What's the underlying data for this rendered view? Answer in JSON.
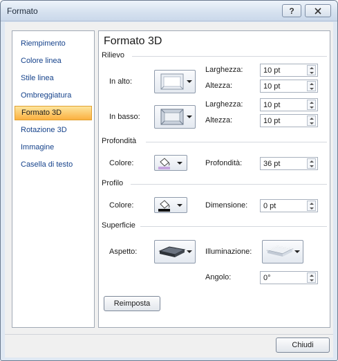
{
  "window": {
    "title": "Formato",
    "help_label": "?",
    "close_label": "☒"
  },
  "nav": {
    "items": [
      {
        "label": "Riempimento"
      },
      {
        "label": "Colore linea"
      },
      {
        "label": "Stile linea"
      },
      {
        "label": "Ombreggiatura"
      },
      {
        "label": "Formato 3D",
        "selected": true
      },
      {
        "label": "Rotazione 3D"
      },
      {
        "label": "Immagine"
      },
      {
        "label": "Casella di testo"
      }
    ]
  },
  "panel": {
    "title": "Formato 3D",
    "rilievo": {
      "label": "Rilievo",
      "top_label": "In alto:",
      "bottom_label": "In basso:",
      "top_width_label": "Larghezza:",
      "top_width_value": "10 pt",
      "top_height_label": "Altezza:",
      "top_height_value": "10 pt",
      "bottom_width_label": "Larghezza:",
      "bottom_width_value": "10 pt",
      "bottom_height_label": "Altezza:",
      "bottom_height_value": "10 pt"
    },
    "profondita": {
      "label": "Profondità",
      "color_label": "Colore:",
      "depth_label": "Profondità:",
      "depth_value": "36 pt"
    },
    "profilo": {
      "label": "Profilo",
      "color_label": "Colore:",
      "size_label": "Dimensione:",
      "size_value": "0 pt"
    },
    "superficie": {
      "label": "Superficie",
      "material_label": "Aspetto:",
      "lighting_label": "Illuminazione:",
      "angle_label": "Angolo:",
      "angle_value": "0°"
    },
    "reset_label": "Reimposta"
  },
  "footer": {
    "close_label": "Chiudi"
  },
  "colors": {
    "depth_color": "#c6a5e0",
    "contour_color": "#111111",
    "accent_selected": "#fbb040",
    "nav_text": "#15428b"
  },
  "icons": {
    "bevel_top": "bevel-top-icon",
    "bevel_bottom": "bevel-bottom-icon",
    "paint_bucket": "paint-bucket-icon",
    "material": "material-icon",
    "lighting": "lighting-icon"
  }
}
